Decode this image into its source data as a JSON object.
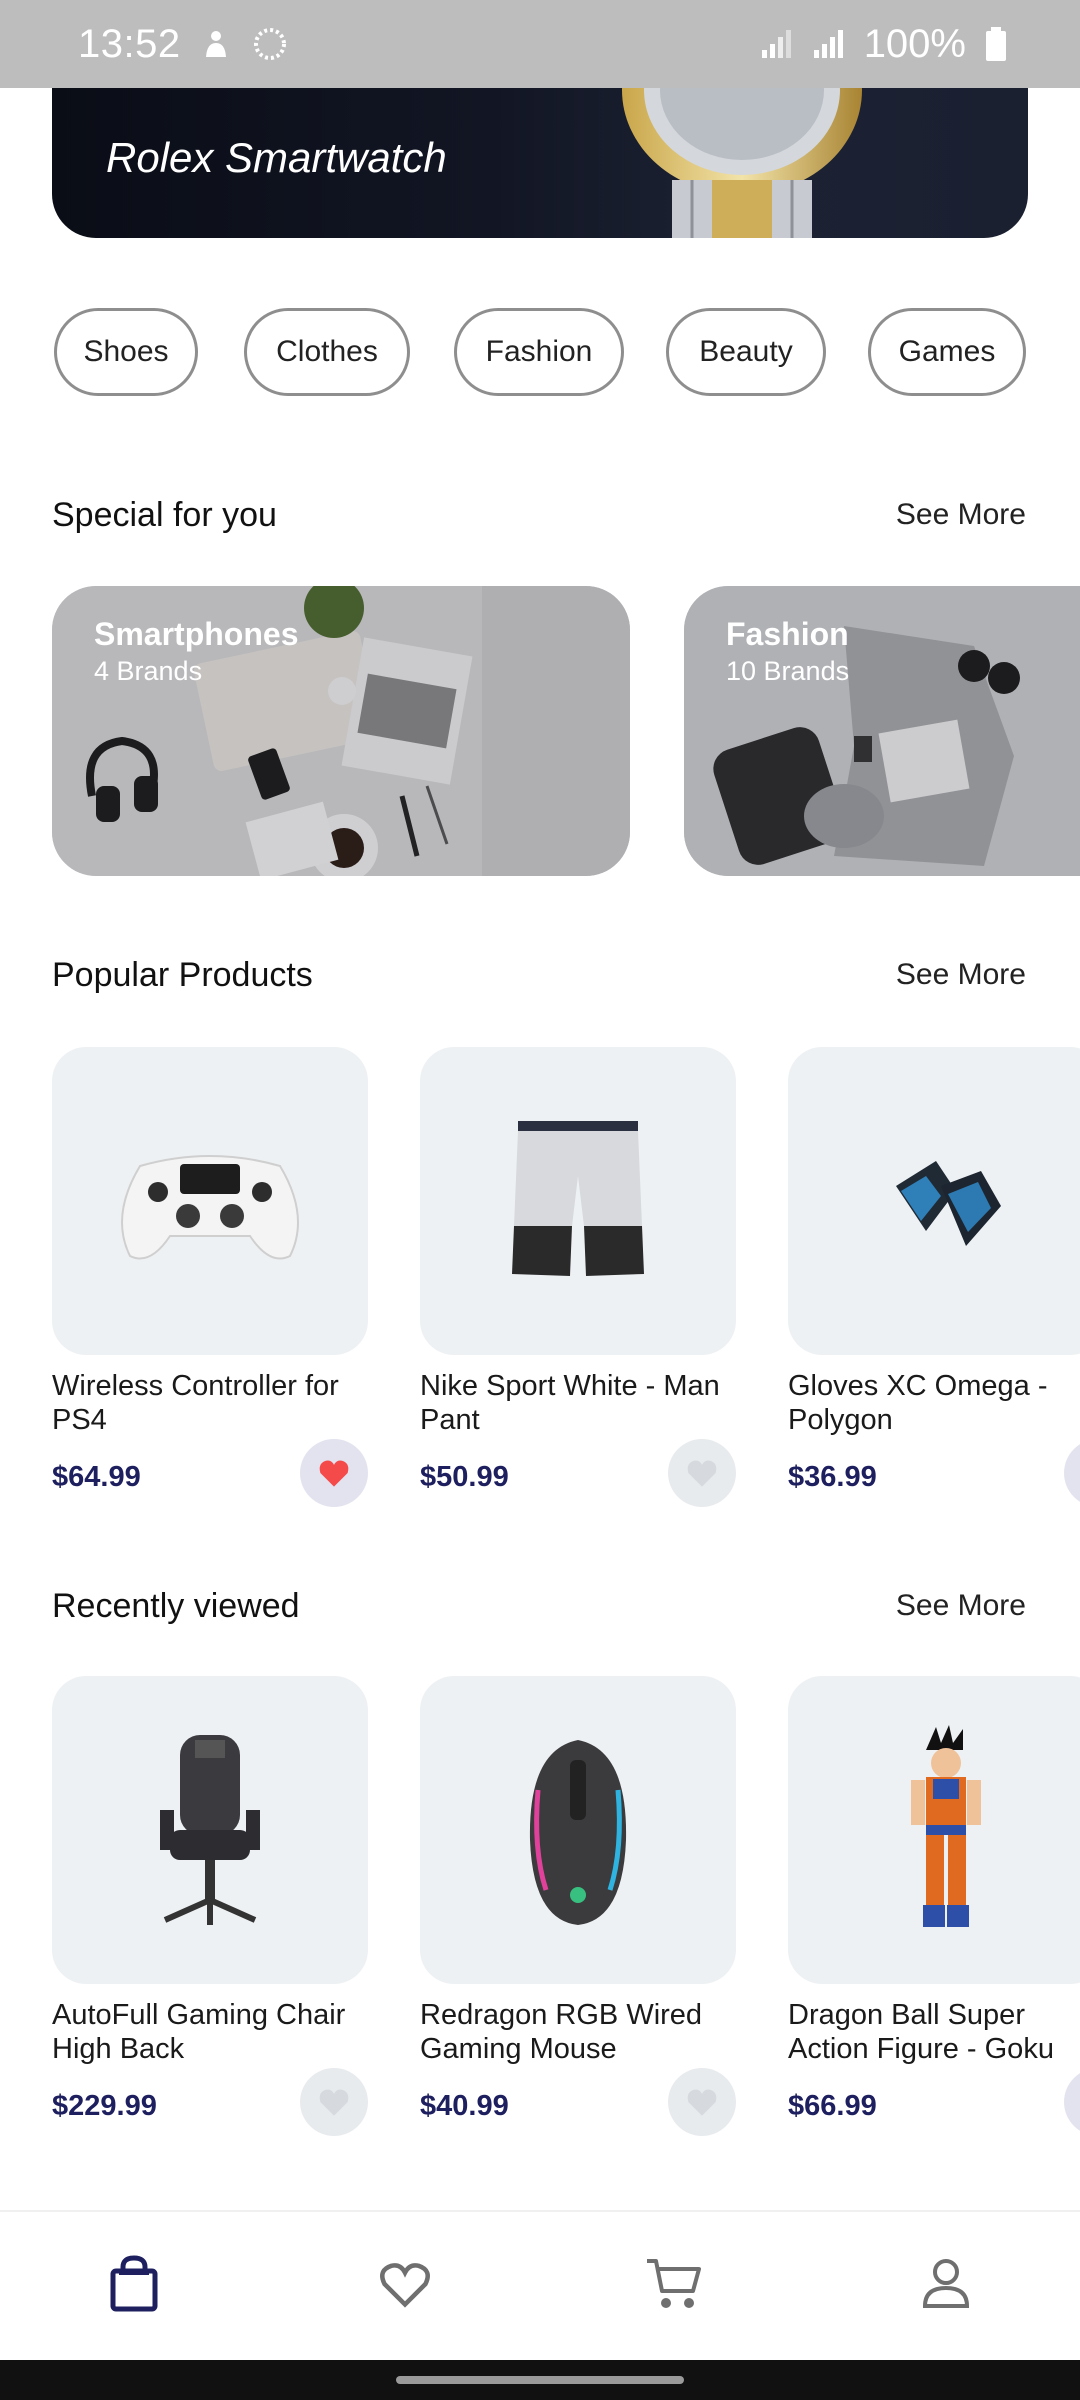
{
  "status_bar": {
    "time": "13:52",
    "battery": "100%"
  },
  "banner": {
    "title": "Rolex Smartwatch"
  },
  "categories": [
    "Shoes",
    "Clothes",
    "Fashion",
    "Beauty",
    "Games"
  ],
  "special": {
    "title": "Special for you",
    "see_more": "See More",
    "cards": [
      {
        "title": "Smartphones",
        "subtitle": "4 Brands"
      },
      {
        "title": "Fashion",
        "subtitle": "10 Brands"
      }
    ]
  },
  "popular": {
    "title": "Popular Products",
    "see_more": "See More",
    "items": [
      {
        "name": "Wireless Controller for PS4",
        "price": "$64.99",
        "favorite": true,
        "icon": "gamepad-icon"
      },
      {
        "name": "Nike Sport White - Man Pant",
        "price": "$50.99",
        "favorite": false,
        "icon": "shorts-icon"
      },
      {
        "name": "Gloves XC Omega - Polygon",
        "price": "$36.99",
        "favorite": true,
        "icon": "gloves-icon"
      }
    ]
  },
  "recent": {
    "title": "Recently viewed",
    "see_more": "See More",
    "items": [
      {
        "name": "AutoFull Gaming Chair High Back",
        "price": "$229.99",
        "favorite": false,
        "icon": "chair-icon"
      },
      {
        "name": "Redragon RGB Wired Gaming Mouse",
        "price": "$40.99",
        "favorite": false,
        "icon": "mouse-icon"
      },
      {
        "name": "Dragon Ball Super Action Figure - Goku",
        "price": "$66.99",
        "favorite": true,
        "icon": "figure-icon"
      }
    ]
  },
  "nav": {
    "items": [
      "shop-icon",
      "heart-icon",
      "cart-icon",
      "profile-icon"
    ],
    "active": "shop-icon"
  },
  "colors": {
    "price": "#1e1f5e",
    "fav_active": "#f44a4a",
    "fav_inactive": "#d6d9de",
    "nav_active": "#1e1f5e",
    "nav_inactive": "#6f6f6f"
  }
}
